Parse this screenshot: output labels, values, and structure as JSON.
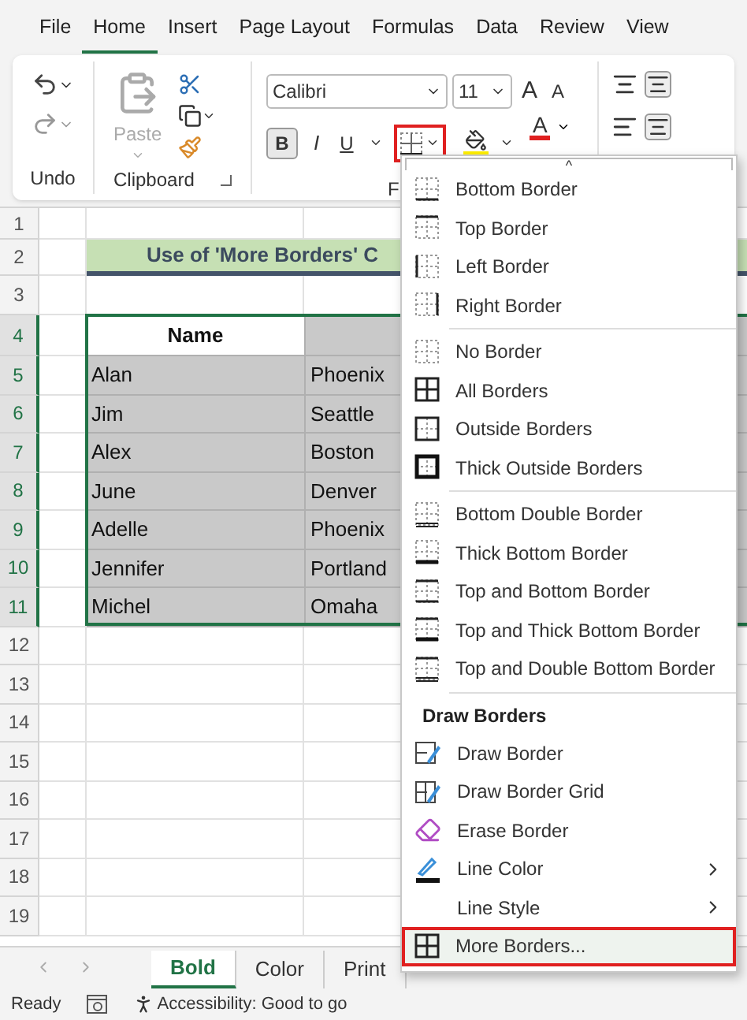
{
  "ribbon_tabs": [
    {
      "label": "File",
      "selected": false
    },
    {
      "label": "Home",
      "selected": true
    },
    {
      "label": "Insert",
      "selected": false
    },
    {
      "label": "Page Layout",
      "selected": false
    },
    {
      "label": "Formulas",
      "selected": false
    },
    {
      "label": "Data",
      "selected": false
    },
    {
      "label": "Review",
      "selected": false
    },
    {
      "label": "View",
      "selected": false
    }
  ],
  "ribbon": {
    "groups": [
      "Undo",
      "Clipboard",
      "F"
    ],
    "paste_label": "Paste",
    "font_name": "Calibri",
    "font_size": "11",
    "bold": "B",
    "italic": "I",
    "underline": "U",
    "grow_font": "A",
    "shrink_font": "A",
    "font_color": "A"
  },
  "sheet": {
    "row_numbers": [
      "1",
      "2",
      "3",
      "4",
      "5",
      "6",
      "7",
      "8",
      "9",
      "10",
      "11",
      "12",
      "13",
      "14",
      "15",
      "16",
      "17",
      "18",
      "19"
    ],
    "title": "Use of 'More Borders' C",
    "header_name": "Name",
    "rows": [
      {
        "name": "Alan",
        "city": "Phoenix"
      },
      {
        "name": "Jim",
        "city": "Seattle"
      },
      {
        "name": "Alex",
        "city": "Boston"
      },
      {
        "name": "June",
        "city": "Denver"
      },
      {
        "name": "Adelle",
        "city": "Phoenix"
      },
      {
        "name": "Jennifer",
        "city": "Portland"
      },
      {
        "name": "Michel",
        "city": "Omaha"
      }
    ]
  },
  "border_menu": {
    "scroll_mark": "^",
    "items": [
      {
        "kind": "item",
        "label": "Bottom Border",
        "selected": false
      },
      {
        "kind": "item",
        "label": "Top Border",
        "selected": false
      },
      {
        "kind": "item",
        "label": "Left Border",
        "selected": false
      },
      {
        "kind": "item",
        "label": "Right Border",
        "selected": false
      },
      {
        "kind": "separator"
      },
      {
        "kind": "item",
        "label": "No Border",
        "selected": false
      },
      {
        "kind": "item",
        "label": "All Borders",
        "selected": false
      },
      {
        "kind": "item",
        "label": "Outside Borders",
        "selected": false
      },
      {
        "kind": "item",
        "label": "Thick Outside Borders",
        "selected": false
      },
      {
        "kind": "separator"
      },
      {
        "kind": "item",
        "label": "Bottom Double Border",
        "selected": false
      },
      {
        "kind": "item",
        "label": "Thick Bottom Border",
        "selected": false
      },
      {
        "kind": "item",
        "label": "Top and Bottom Border",
        "selected": false
      },
      {
        "kind": "item",
        "label": "Top and Thick Bottom Border",
        "selected": false
      },
      {
        "kind": "item",
        "label": "Top and Double Bottom Border",
        "selected": false
      },
      {
        "kind": "separator"
      },
      {
        "kind": "header",
        "label": "Draw Borders"
      },
      {
        "kind": "item",
        "label": "Draw Border",
        "selected": false
      },
      {
        "kind": "item",
        "label": "Draw Border Grid",
        "selected": false
      },
      {
        "kind": "item",
        "label": "Erase Border",
        "selected": false
      },
      {
        "kind": "item",
        "label": "Line Color",
        "selected": false,
        "submenu": true
      },
      {
        "kind": "item",
        "label": "Line Style",
        "selected": false,
        "submenu": true
      },
      {
        "kind": "item",
        "label": "More Borders...",
        "selected": true
      }
    ]
  },
  "sheet_tabs": [
    {
      "label": "Bold",
      "selected": true
    },
    {
      "label": "Color",
      "selected": false
    },
    {
      "label": "Print",
      "selected": false
    }
  ],
  "status_bar": {
    "ready": "Ready",
    "accessibility": "Accessibility: Good to go"
  }
}
